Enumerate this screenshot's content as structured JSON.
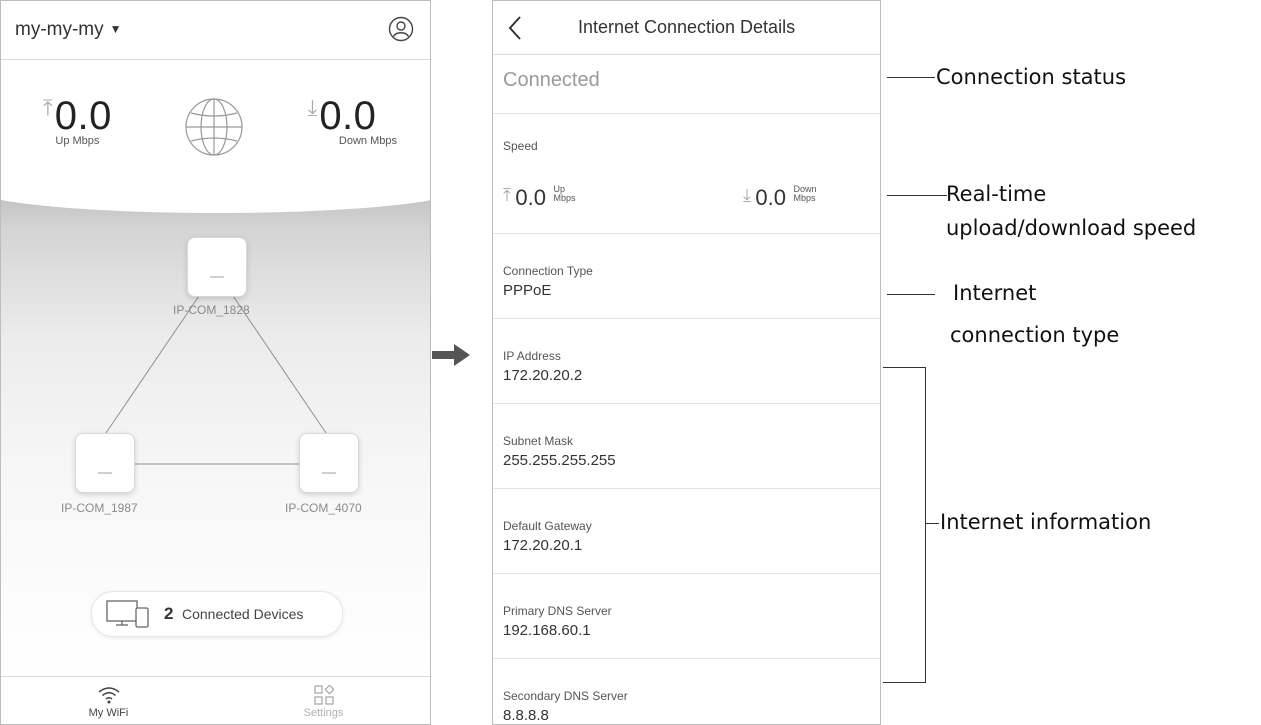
{
  "left_phone": {
    "network_name": "my-my-my",
    "caret": "▼",
    "speed": {
      "up_value": "0.0",
      "up_unit": "Up Mbps",
      "down_value": "0.0",
      "down_unit": "Down Mbps",
      "up_arrow": "⤒",
      "down_arrow": "⤓"
    },
    "nodes": [
      {
        "label": "IP-COM_1828"
      },
      {
        "label": "IP-COM_1987"
      },
      {
        "label": "IP-COM_4070"
      }
    ],
    "devices": {
      "count": "2",
      "label": "Connected Devices"
    },
    "tabs": [
      {
        "label": "My WiFi",
        "icon": "wifi-icon"
      },
      {
        "label": "Settings",
        "icon": "settings-icon"
      }
    ]
  },
  "right_phone": {
    "title": "Internet Connection Details",
    "status": "Connected",
    "speed": {
      "label": "Speed",
      "up_value": "0.0",
      "up_unit_top": "Up",
      "up_unit_bottom": "Mbps",
      "down_value": "0.0",
      "down_unit_top": "Down",
      "down_unit_bottom": "Mbps",
      "up_arrow": "⤒",
      "down_arrow": "⤓"
    },
    "rows": [
      {
        "label": "Connection Type",
        "value": "PPPoE"
      },
      {
        "label": "IP Address",
        "value": "172.20.20.2"
      },
      {
        "label": "Subnet Mask",
        "value": "255.255.255.255"
      },
      {
        "label": "Default Gateway",
        "value": "172.20.20.1"
      },
      {
        "label": "Primary DNS Server",
        "value": "192.168.60.1"
      },
      {
        "label": "Secondary DNS Server",
        "value": "8.8.8.8"
      }
    ]
  },
  "annotations": {
    "connection_status": "Connection status",
    "realtime_line1": "Real-time",
    "realtime_line2": "upload/download speed",
    "conn_type_line1": "Internet",
    "conn_type_line2": "connection type",
    "internet_info": "Internet information"
  },
  "colors": {
    "border": "#bdbdbd",
    "muted_text": "#9a9a9a",
    "arrow": "#555555"
  }
}
